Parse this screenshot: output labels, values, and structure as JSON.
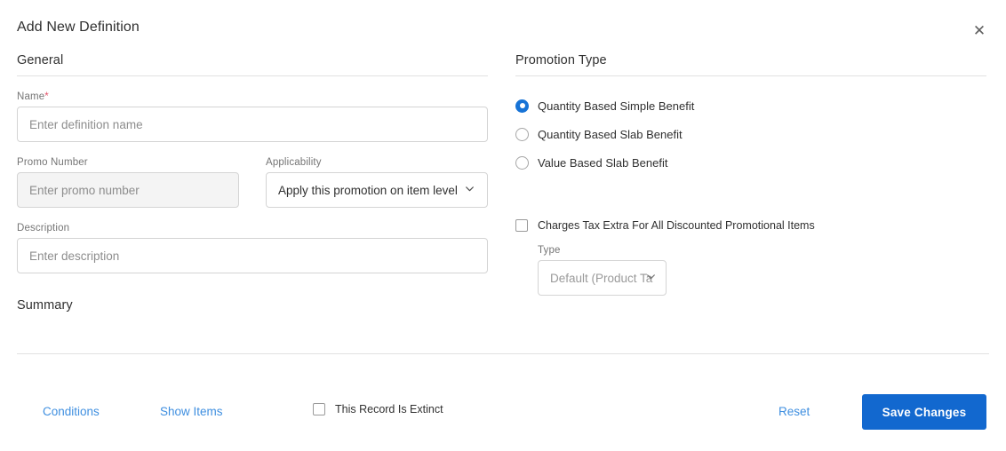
{
  "dialog": {
    "title": "Add New Definition",
    "close_icon": "close-icon"
  },
  "general": {
    "heading": "General",
    "name": {
      "label": "Name",
      "required_marker": "*",
      "placeholder": "Enter definition name",
      "value": ""
    },
    "promo_number": {
      "label": "Promo Number",
      "placeholder": "Enter promo number",
      "value": "",
      "disabled": true
    },
    "applicability": {
      "label": "Applicability",
      "selected": "Apply this promotion on item level",
      "chevron_icon": "chevron-down-icon"
    },
    "description": {
      "label": "Description",
      "placeholder": "Enter description",
      "value": ""
    },
    "summary_heading": "Summary"
  },
  "promotion_type": {
    "heading": "Promotion Type",
    "options": [
      {
        "label": "Quantity Based Simple Benefit",
        "selected": true
      },
      {
        "label": "Quantity Based Slab Benefit",
        "selected": false
      },
      {
        "label": "Value Based Slab Benefit",
        "selected": false
      }
    ],
    "tax_checkbox": {
      "label": "Charges Tax Extra For All Discounted Promotional Items",
      "checked": false
    },
    "type": {
      "label": "Type",
      "selected": "Default (Product Ta",
      "chevron_icon": "chevron-down-icon"
    }
  },
  "footer": {
    "conditions_label": "Conditions",
    "show_items_label": "Show Items",
    "extinct_checkbox": {
      "label": "This Record Is Extinct",
      "checked": false
    },
    "reset_label": "Reset",
    "save_label": "Save Changes"
  },
  "colors": {
    "accent_blue": "#1268cf",
    "link_blue": "#3f8fe0",
    "radio_blue": "#1773d6",
    "required_red": "#e2546a",
    "divider": "#e2e2e2"
  }
}
